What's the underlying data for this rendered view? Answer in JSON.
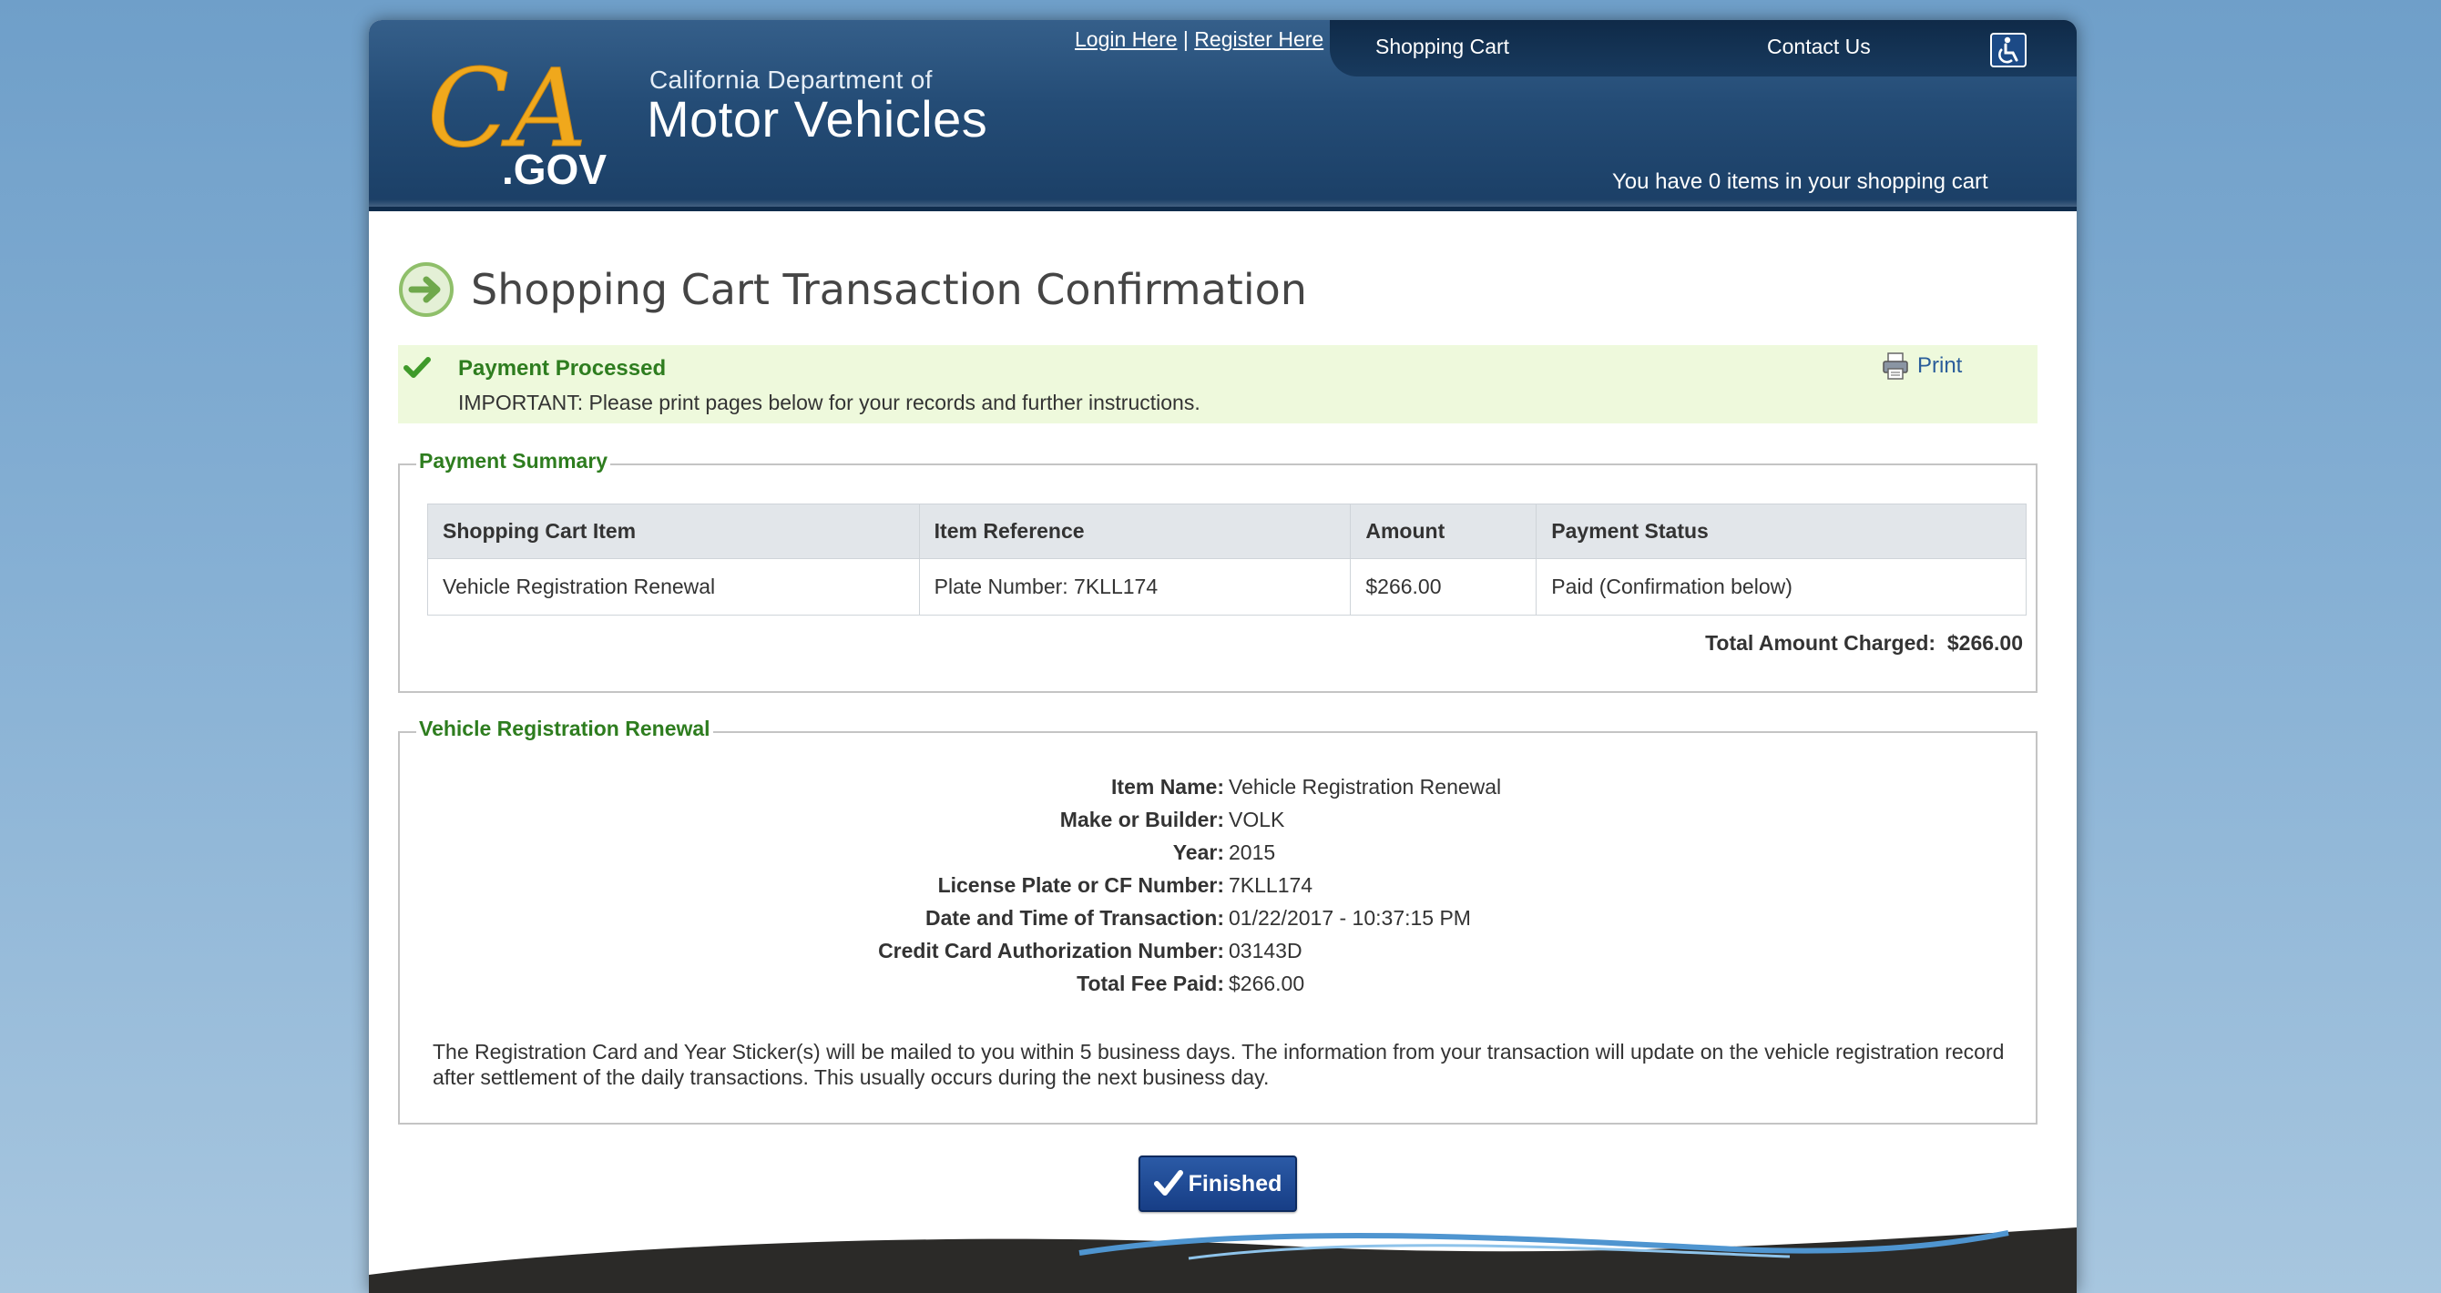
{
  "header": {
    "dept_line1": "California Department of",
    "dept_line2": "Motor Vehicles",
    "logo_text_ca": "CA",
    "logo_text_gov": ".GOV",
    "login_label": "Login Here",
    "link_separator": "|",
    "register_label": "Register Here",
    "nav": {
      "cart_label": "Shopping Cart",
      "contact_label": "Contact Us"
    },
    "cart_count_text": "You have 0 items in your shopping cart",
    "accessibility_icon": "accessibility-icon"
  },
  "main": {
    "title": "Shopping Cart Transaction Confirmation",
    "alert": {
      "title": "Payment Processed",
      "message": "IMPORTANT: Please print pages below for your records and further instructions.",
      "print_label": "Print"
    },
    "payment_summary": {
      "legend": "Payment Summary",
      "headers": [
        "Shopping Cart Item",
        "Item Reference",
        "Amount",
        "Payment Status"
      ],
      "rows": [
        [
          "Vehicle Registration Renewal",
          "Plate Number: 7KLL174",
          "$266.00",
          "Paid (Confirmation below)"
        ]
      ],
      "total_label": "Total Amount Charged:",
      "total_value": "$266.00"
    },
    "renewal": {
      "legend": "Vehicle Registration Renewal",
      "details": [
        {
          "label": "Item Name:",
          "value": "Vehicle Registration Renewal"
        },
        {
          "label": "Make or Builder:",
          "value": "VOLK"
        },
        {
          "label": "Year:",
          "value": "2015"
        },
        {
          "label": "License Plate or CF Number:",
          "value": "7KLL174"
        },
        {
          "label": "Date and Time of Transaction:",
          "value": "01/22/2017 - 10:37:15 PM"
        },
        {
          "label": "Credit Card Authorization Number:",
          "value": "03143D"
        },
        {
          "label": "Total Fee Paid:",
          "value": "$266.00"
        }
      ],
      "note": "The Registration Card and Year Sticker(s) will be mailed to you within 5 business days. The information from your transaction will update on the vehicle registration record after settlement of the daily transactions. This usually occurs during the next business day."
    },
    "finished_label": "Finished"
  },
  "colors": {
    "header_blue": "#244c76",
    "accent_green": "#2e7d1f",
    "alert_bg": "#eef9dc",
    "button_blue": "#173e86",
    "logo_gold": "#f0a81c"
  }
}
